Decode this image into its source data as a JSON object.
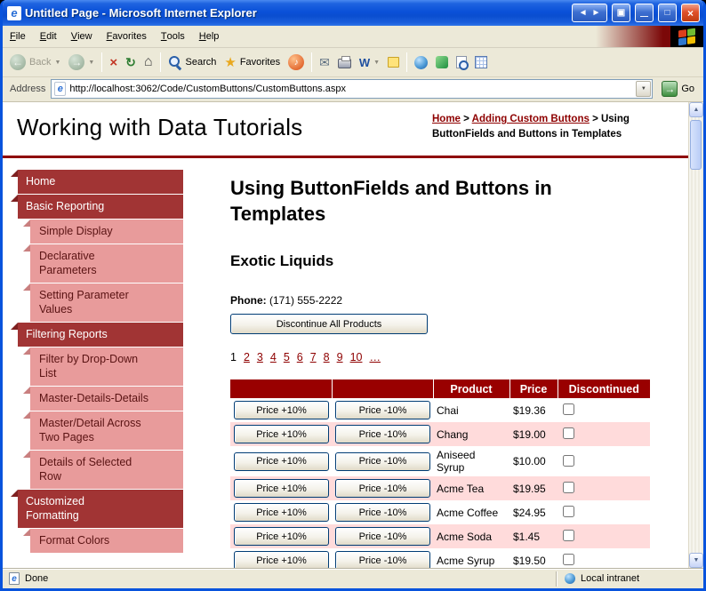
{
  "colors": {
    "vars": {
      "maroon": "#990000",
      "nav-dark": "#A13434",
      "nav-light": "#E89B9B",
      "row-alt": "#FFDBDB",
      "chrome": "#ECE9D8",
      "xp-blue": "#0853DD"
    },
    "windows_flag": [
      "#DD3F1C",
      "#71BC32",
      "#2E77D0",
      "#F2BE00"
    ]
  },
  "window": {
    "title": "Untitled Page - Microsoft Internet Explorer"
  },
  "menu": {
    "items": [
      "File",
      "Edit",
      "View",
      "Favorites",
      "Tools",
      "Help"
    ]
  },
  "toolbar": {
    "back_label": "Back",
    "search_label": "Search",
    "favorites_label": "Favorites"
  },
  "address": {
    "label": "Address",
    "url": "http://localhost:3062/Code/CustomButtons/CustomButtons.aspx",
    "go_label": "Go"
  },
  "header": {
    "site_title": "Working with Data Tutorials",
    "breadcrumb": {
      "links": [
        "Home",
        "Adding Custom Buttons"
      ],
      "separator": ">",
      "current": "Using ButtonFields and Buttons in Templates"
    }
  },
  "sidebar": {
    "items": [
      {
        "label": "Home",
        "level": 1
      },
      {
        "label": "Basic Reporting",
        "level": 1
      },
      {
        "label": "Simple Display",
        "level": 2
      },
      {
        "label": "Declarative Parameters",
        "level": 2
      },
      {
        "label": "Setting Parameter Values",
        "level": 2
      },
      {
        "label": "Filtering Reports",
        "level": 1
      },
      {
        "label": "Filter by Drop-Down List",
        "level": 2
      },
      {
        "label": "Master-Details-Details",
        "level": 2
      },
      {
        "label": "Master/Detail Across Two Pages",
        "level": 2
      },
      {
        "label": "Details of Selected Row",
        "level": 2
      },
      {
        "label": "Customized Formatting",
        "level": 1
      },
      {
        "label": "Format Colors",
        "level": 2
      }
    ]
  },
  "main": {
    "page_title": "Using ButtonFields and Buttons in Templates",
    "supplier_name": "Exotic Liquids",
    "phone_label": "Phone:",
    "phone_value": "(171) 555-2222",
    "discontinue_all_label": "Discontinue All Products",
    "pager": {
      "current": "1",
      "pages": [
        "2",
        "3",
        "4",
        "5",
        "6",
        "7",
        "8",
        "9",
        "10",
        "…"
      ]
    },
    "grid": {
      "headers": [
        "",
        "",
        "Product",
        "Price",
        "Discontinued"
      ],
      "increase_label": "Price +10%",
      "decrease_label": "Price -10%",
      "rows": [
        {
          "product": "Chai",
          "price": "$19.36",
          "discontinued": false
        },
        {
          "product": "Chang",
          "price": "$19.00",
          "discontinued": false
        },
        {
          "product": "Aniseed Syrup",
          "price": "$10.00",
          "discontinued": false
        },
        {
          "product": "Acme Tea",
          "price": "$19.95",
          "discontinued": false
        },
        {
          "product": "Acme Coffee",
          "price": "$24.95",
          "discontinued": false
        },
        {
          "product": "Acme Soda",
          "price": "$1.45",
          "discontinued": false
        },
        {
          "product": "Acme Syrup",
          "price": "$19.50",
          "discontinued": false
        }
      ]
    }
  },
  "statusbar": {
    "status": "Done",
    "zone": "Local intranet"
  },
  "icons": {
    "ie_e": "e",
    "nav_left": "◄",
    "nav_right": "►",
    "window_glyph": "▣",
    "minimize": "—",
    "maximize": "□",
    "close": "×",
    "back_arrow": "←",
    "forward_arrow": "→",
    "dropdown": "▼",
    "stop": "×",
    "refresh": "↻",
    "home": "⌂",
    "star": "★",
    "note": "♪",
    "mail": "✉",
    "edit_w": "W",
    "go_arrow": "→",
    "scroll_up": "▲",
    "scroll_down": "▼"
  }
}
